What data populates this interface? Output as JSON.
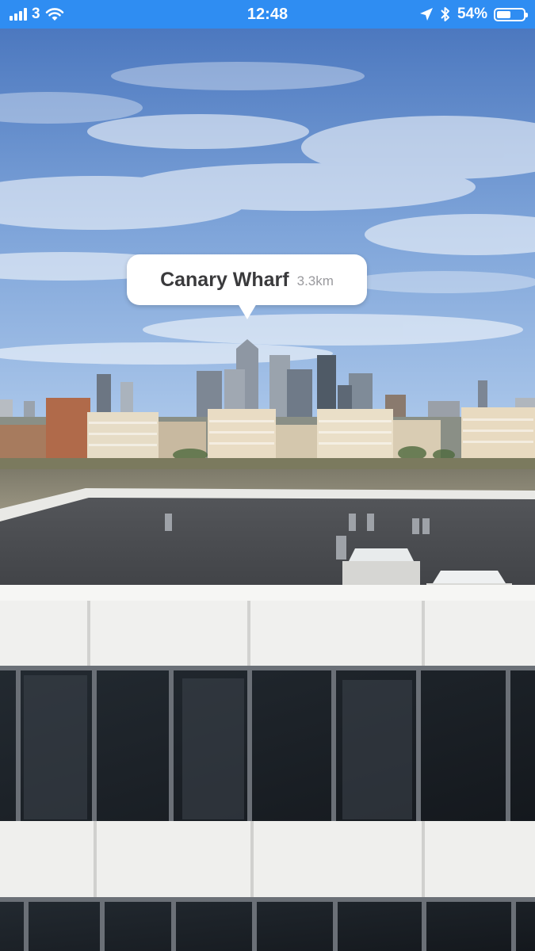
{
  "status_bar": {
    "carrier": "3",
    "time": "12:48",
    "battery_percent": "54%",
    "battery_level": 0.54,
    "icons": [
      "signal-bars-icon",
      "wifi-icon",
      "location-arrow-icon",
      "bluetooth-icon",
      "battery-icon"
    ]
  },
  "ar_label": {
    "name": "Canary Wharf",
    "distance": "3.3km"
  },
  "colors": {
    "status_bar": "#2f8df2",
    "sky_top": "#4c78bf",
    "sky_horizon": "#a9c7ea",
    "river": "#8a8572",
    "roof": "#4a4c50",
    "facade_white": "#f2f2f0",
    "glass": "#1b2026"
  }
}
